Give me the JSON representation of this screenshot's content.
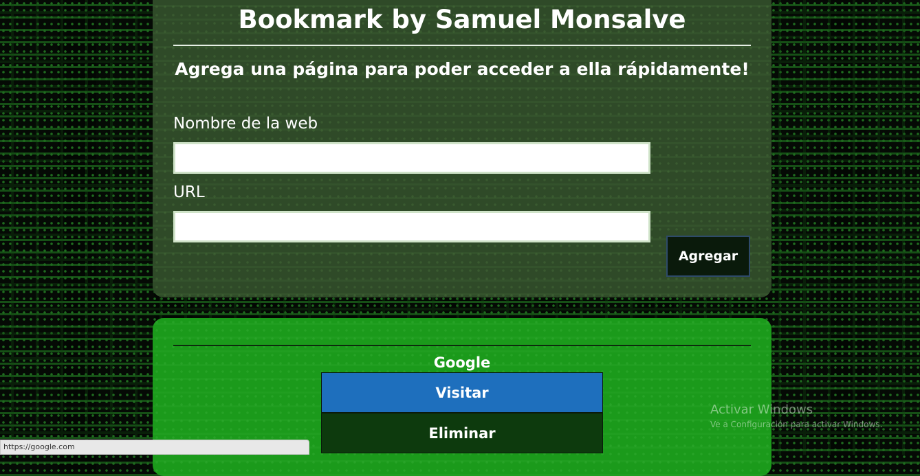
{
  "header": {
    "title": "Bookmark by Samuel Monsalve",
    "subtitle": "Agrega una página para poder acceder a ella rápidamente!"
  },
  "form": {
    "name_label": "Nombre de la web",
    "name_value": "",
    "url_label": "URL",
    "url_value": "",
    "add_label": "Agregar"
  },
  "bookmarks": [
    {
      "name": "Google",
      "visit_label": "Visitar",
      "delete_label": "Eliminar"
    }
  ],
  "status_bar": {
    "url": "https://google.com"
  },
  "watermark": {
    "title": "Activar Windows",
    "subtitle": "Ve a Configuración para activar Windows."
  },
  "colors": {
    "form_card": "#2f4a28",
    "list_card": "#1b9a1b",
    "visit_button": "#1e6fbd",
    "delete_button": "#0d3a0d",
    "add_button": "#0a1a0b"
  }
}
